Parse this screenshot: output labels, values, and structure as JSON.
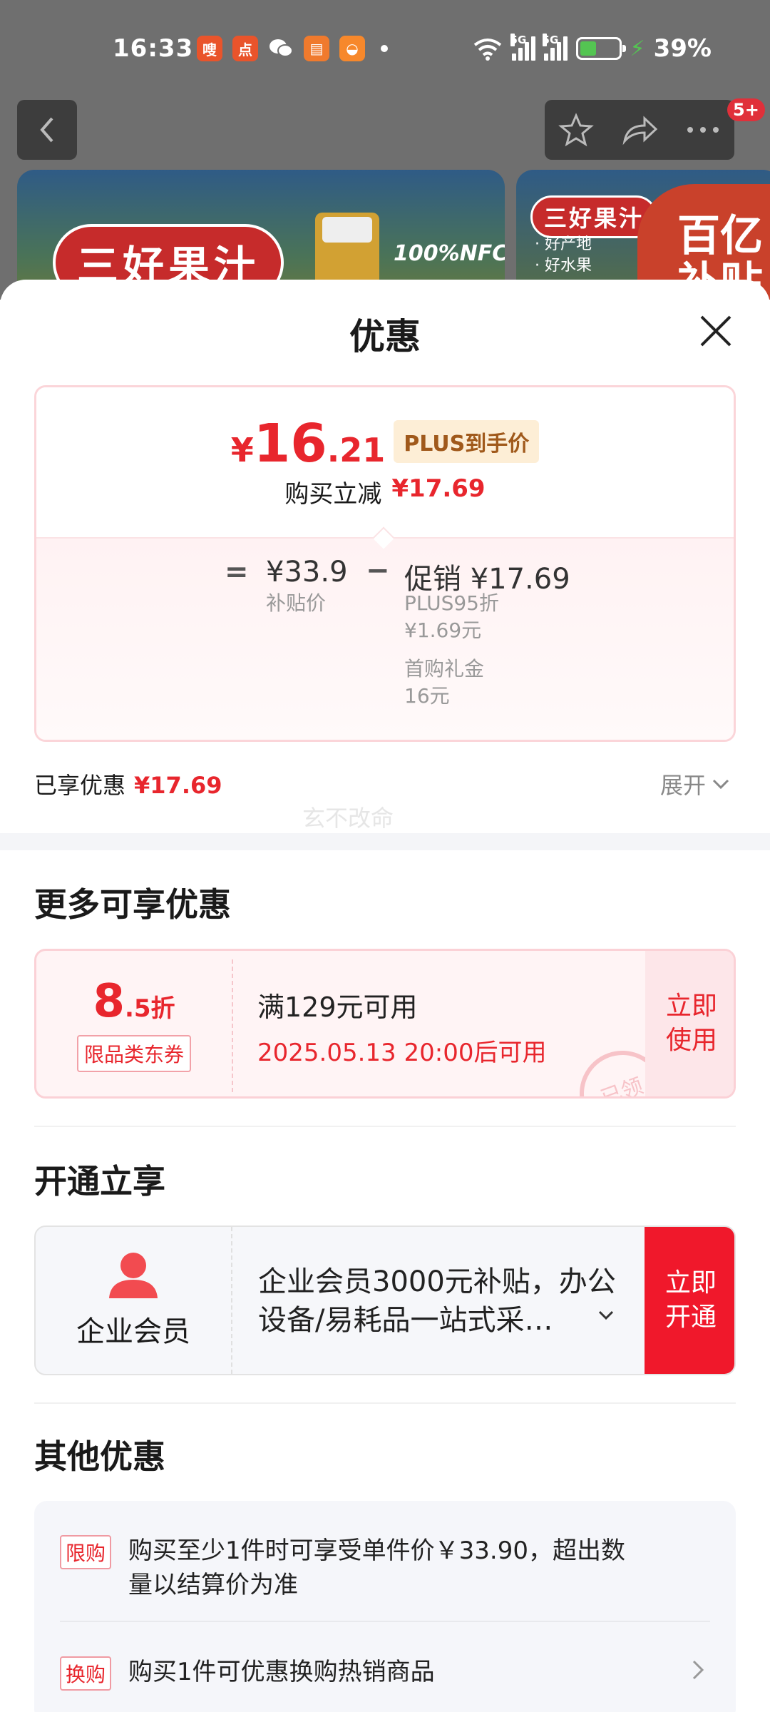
{
  "status_bar": {
    "time": "16:33",
    "battery": "39%",
    "network_badges": [
      "5G",
      "5G"
    ],
    "app_icons": [
      {
        "name": "app-red-icon",
        "glyph": "嗖",
        "color": "#e9542b"
      },
      {
        "name": "app-dianping-icon",
        "glyph": "点",
        "color": "#e9542b"
      },
      {
        "name": "wechat-icon",
        "glyph": "◉",
        "color": "transparent"
      },
      {
        "name": "app-book-icon",
        "glyph": "▤",
        "color": "#f07a2d"
      },
      {
        "name": "app-taobao-icon",
        "glyph": "◒",
        "color": "#f7882b"
      }
    ]
  },
  "top_nav": {
    "badge": "5+"
  },
  "banners": {
    "banner1_title": "三好果汁",
    "banner1_label": "100%NFC",
    "banner2_title": "三好果汁",
    "banner2_lines": [
      "· 好产地",
      "· 好水果"
    ],
    "banner2_big": "百亿\n补贴"
  },
  "sheet": {
    "title": "优惠"
  },
  "price_card": {
    "currency": "¥",
    "price_int": "16",
    "price_dec": ".21",
    "plus_tag": "PLUS到手价",
    "reduce_label": "购买立减",
    "reduce_amount": "¥17.69",
    "eq_op": "=",
    "subsidy_price": "¥33.9",
    "subsidy_label": "补贴价",
    "minus_op": "−",
    "promo_line": "促销 ¥17.69",
    "promo_items": [
      "PLUS95折",
      "¥1.69元",
      "首购礼金",
      "16元"
    ]
  },
  "enjoyed": {
    "label": "已享优惠",
    "amount": "¥17.69",
    "expand": "展开"
  },
  "watermark": "玄不改命",
  "more_offers": {
    "title": "更多可享优惠",
    "coupon": {
      "discount_int": "8",
      "discount_dec": ".5折",
      "tag": "限品类东券",
      "condition": "满129元可用",
      "date": "2025.05.13 20:00后可用",
      "stamp": "已领",
      "button_line1": "立即",
      "button_line2": "使用"
    }
  },
  "activate": {
    "title": "开通立享",
    "member_label": "企业会员",
    "description": "企业会员3000元补贴，办公设备/易耗品一站式采…",
    "button_line1": "立即",
    "button_line2": "开通"
  },
  "other": {
    "title": "其他优惠",
    "rows": [
      {
        "tag": "限购",
        "text": "购买至少1件时可享受单件价￥33.90，超出数量以结算价为准"
      },
      {
        "tag": "换购",
        "text": "购买1件可优惠换购热销商品"
      }
    ]
  },
  "colors": {
    "accent_red": "#e8262d",
    "button_red": "#f0182b",
    "plus_gold": "#a0591b"
  }
}
